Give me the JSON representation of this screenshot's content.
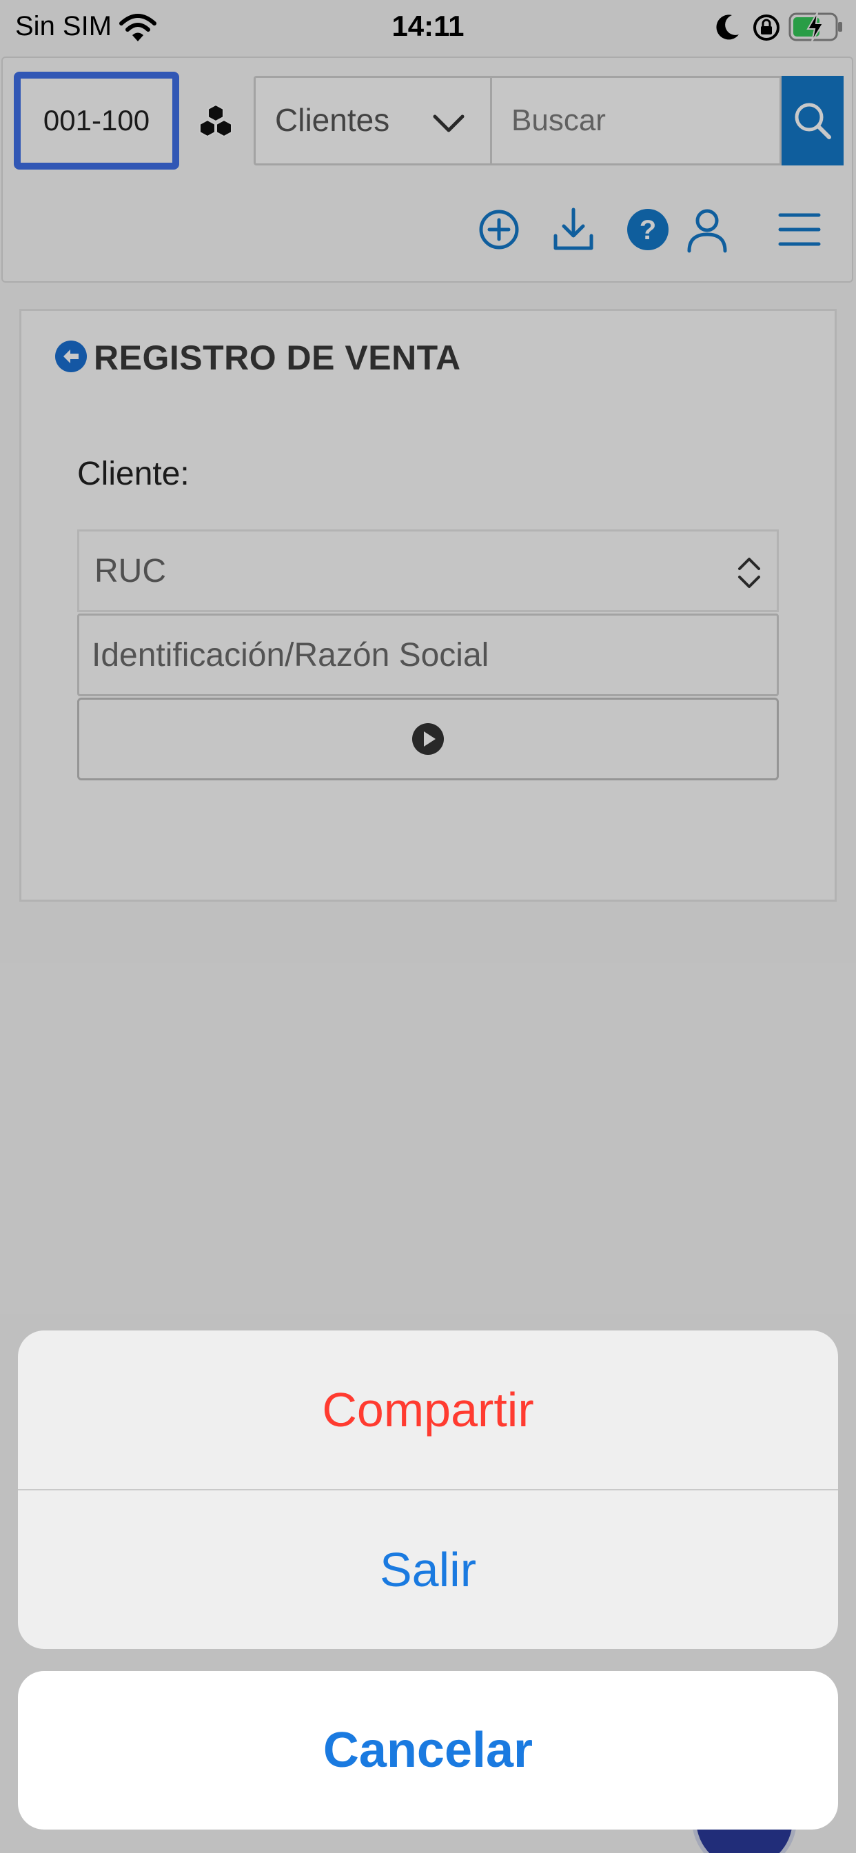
{
  "status_bar": {
    "carrier": "Sin SIM",
    "time": "14:11"
  },
  "header": {
    "branch_code": "001-100",
    "entity_select": "Clientes",
    "search_placeholder": "Buscar",
    "accent_color": "#1478c8"
  },
  "page": {
    "title": "REGISTRO DE VENTA",
    "client_label": "Cliente:",
    "id_type_value": "RUC",
    "id_input_placeholder": "Identificación/Razón Social"
  },
  "action_sheet": {
    "share_label": "Compartir",
    "share_color": "#ff3b30",
    "exit_label": "Salir",
    "cancel_label": "Cancelar",
    "action_color": "#1a7ae0"
  },
  "icons": {
    "status": [
      "wifi-icon",
      "moon-icon",
      "orientation-lock-icon",
      "battery-charging-icon"
    ],
    "toolbar": [
      "cubes-icon",
      "chevron-down-icon",
      "search-icon",
      "add-circle-icon",
      "download-icon",
      "help-icon",
      "user-icon",
      "menu-icon"
    ],
    "card": [
      "back-arrow-icon",
      "sort-arrows-icon",
      "play-icon"
    ]
  }
}
